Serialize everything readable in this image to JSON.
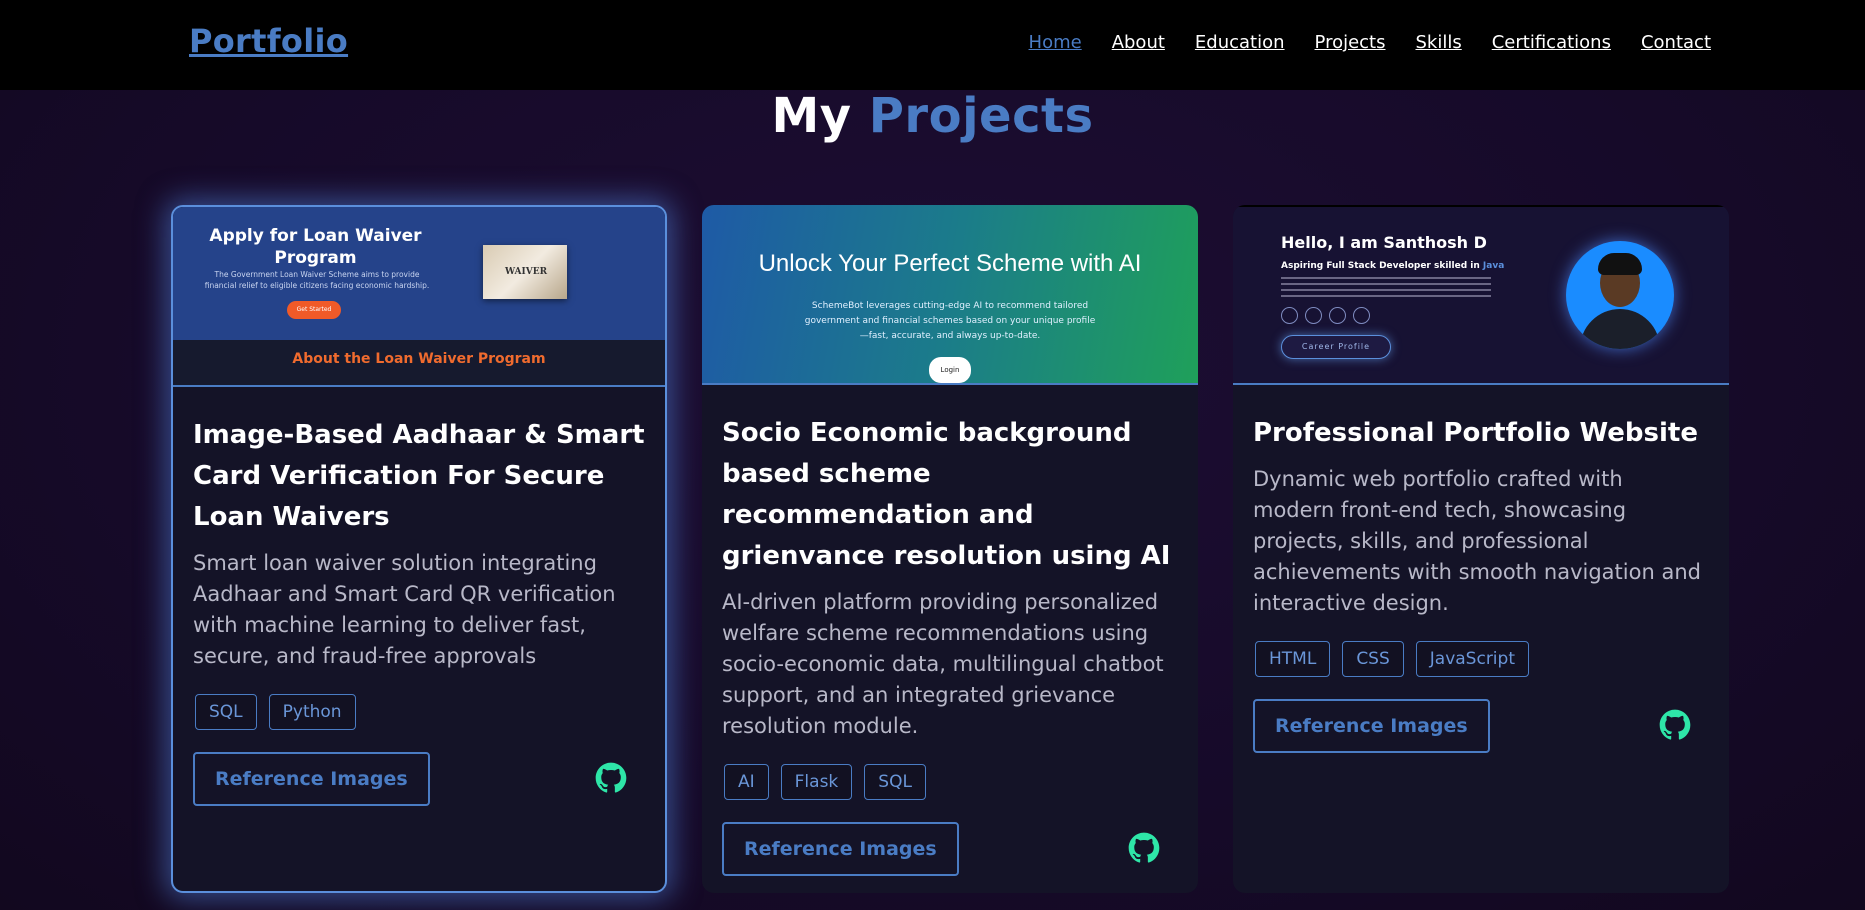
{
  "nav": {
    "logo": "Portfolio",
    "links": [
      "Home",
      "About",
      "Education",
      "Projects",
      "Skills",
      "Certifications",
      "Contact"
    ],
    "active": "Home"
  },
  "heading": {
    "first": "My",
    "accent": "Projects"
  },
  "colors": {
    "accent": "#4a7cc4",
    "github_icon": "#2ee6a8",
    "nav_bg": "#000000"
  },
  "projects": [
    {
      "title": "Image-Based Aadhaar & Smart Card Verification For Secure Loan Waivers",
      "description": "Smart loan waiver solution integrating Aadhaar and Smart Card QR verification with machine learning to deliver fast, secure, and fraud-free approvals",
      "tags": [
        "SQL",
        "Python"
      ],
      "button": "Reference Images",
      "icon": "github-icon",
      "thumb": {
        "heading": "Apply for Loan Waiver Program",
        "text": "The Government Loan Waiver Scheme aims to provide financial relief to eligible citizens facing economic hardship.",
        "button": "Get Started",
        "image_label": "WAIVER",
        "section": "About the Loan Waiver Program"
      }
    },
    {
      "title": "Socio Economic background based scheme recommendation and grienvance resolution using AI",
      "description": "AI-driven platform providing personalized welfare scheme recommendations using socio-economic data, multilingual chatbot support, and an integrated grievance resolution module.",
      "tags": [
        "AI",
        "Flask",
        "SQL"
      ],
      "button": "Reference Images",
      "icon": "github-icon",
      "thumb": {
        "heading": "Unlock Your Perfect Scheme with AI",
        "text": "SchemeBot leverages cutting-edge AI to recommend tailored government and financial schemes based on your unique profile—fast, accurate, and always up-to-date.",
        "button": "Login"
      }
    },
    {
      "title": "Professional Portfolio Website",
      "description": "Dynamic web portfolio crafted with modern front-end tech, showcasing projects, skills, and professional achievements with smooth navigation and interactive design.",
      "tags": [
        "HTML",
        "CSS",
        "JavaScript"
      ],
      "button": "Reference Images",
      "icon": "github-icon",
      "thumb": {
        "heading": "Hello, I am Santhosh D",
        "subheading": "Aspiring Full Stack Developer skilled in",
        "skill": "Java",
        "button": "Career Profile"
      }
    }
  ]
}
